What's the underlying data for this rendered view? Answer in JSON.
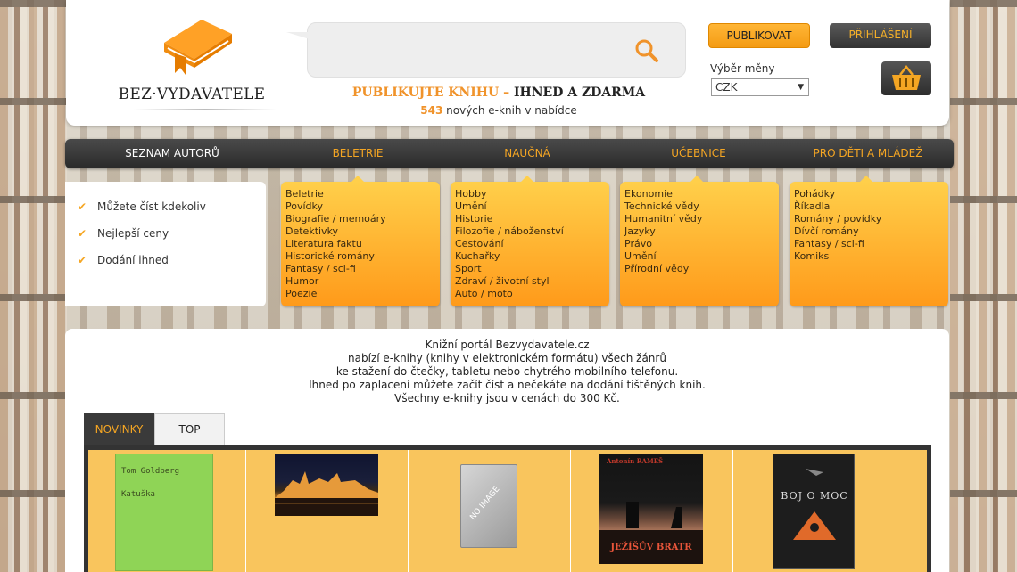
{
  "header": {
    "logo_text": "BEZ·VYDAVATELE",
    "search": {
      "placeholder": ""
    },
    "tagline_orange": "PUBLIKUJTE KNIHU – ",
    "tagline_dark": "IHNED A ZDARMA",
    "new_count": "543",
    "new_count_text": " nových e-knih v nabídce",
    "publish_label": "PUBLIKOVAT",
    "login_label": "PŘIHLÁŠENÍ",
    "currency_label": "Výběr měny",
    "currency_value": "CZK"
  },
  "nav": {
    "authors": "SEZNAM AUTORŮ",
    "categories": [
      "BELETRIE",
      "NAUČNÁ",
      "UČEBNICE",
      "PRO DĚTI A MLÁDEŽ"
    ]
  },
  "features": [
    "Můžete číst kdekoliv",
    "Nejlepší ceny",
    "Dodání ihned"
  ],
  "panels": [
    [
      "Beletrie",
      "Povídky",
      "Biografie / memoáry",
      "Detektivky",
      "Literatura faktu",
      "Historické romány",
      "Fantasy / sci-fi",
      "Humor",
      "Poezie"
    ],
    [
      "Hobby",
      "Umění",
      "Historie",
      "Filozofie / náboženství",
      "Cestování",
      "Kuchařky",
      "Sport",
      "Zdraví / životní styl",
      "Auto / moto"
    ],
    [
      "Ekonomie",
      "Technické vědy",
      "Humanitní vědy",
      "Jazyky",
      "Právo",
      "Umění",
      "Přírodní vědy"
    ],
    [
      "Pohádky",
      "Říkadla",
      "Romány / povídky",
      "Dívčí romány",
      "Fantasy / sci-fi",
      "Komiks"
    ]
  ],
  "intro": [
    "Knižní portál Bezvydavatele.cz",
    "nabízí e-knihy (knihy v elektronickém formátu) všech žánrů",
    "ke stažení do čtečky, tabletu nebo chytrého mobilního telefonu.",
    "Ihned po zaplacení můžete začít číst a nečekáte na dodání tištěných knih.",
    "Všechny e-knihy jsou v cenách do 300 Kč."
  ],
  "tabs": {
    "novinky": "NOVINKY",
    "top": "TOP"
  },
  "books": [
    {
      "author": "Tom Goldberg",
      "title": "Katuška"
    },
    {
      "author": "",
      "title": ""
    },
    {
      "author": "",
      "title": "NO IMAGE"
    },
    {
      "author": "Antonín RAMEŠ",
      "title": "JEŽÍŠŮV BRATR"
    },
    {
      "author": "",
      "title": "BOJ O MOC"
    }
  ],
  "colors": {
    "accent": "#f5a623",
    "dark": "#333333",
    "panel": "#ffb02e"
  }
}
